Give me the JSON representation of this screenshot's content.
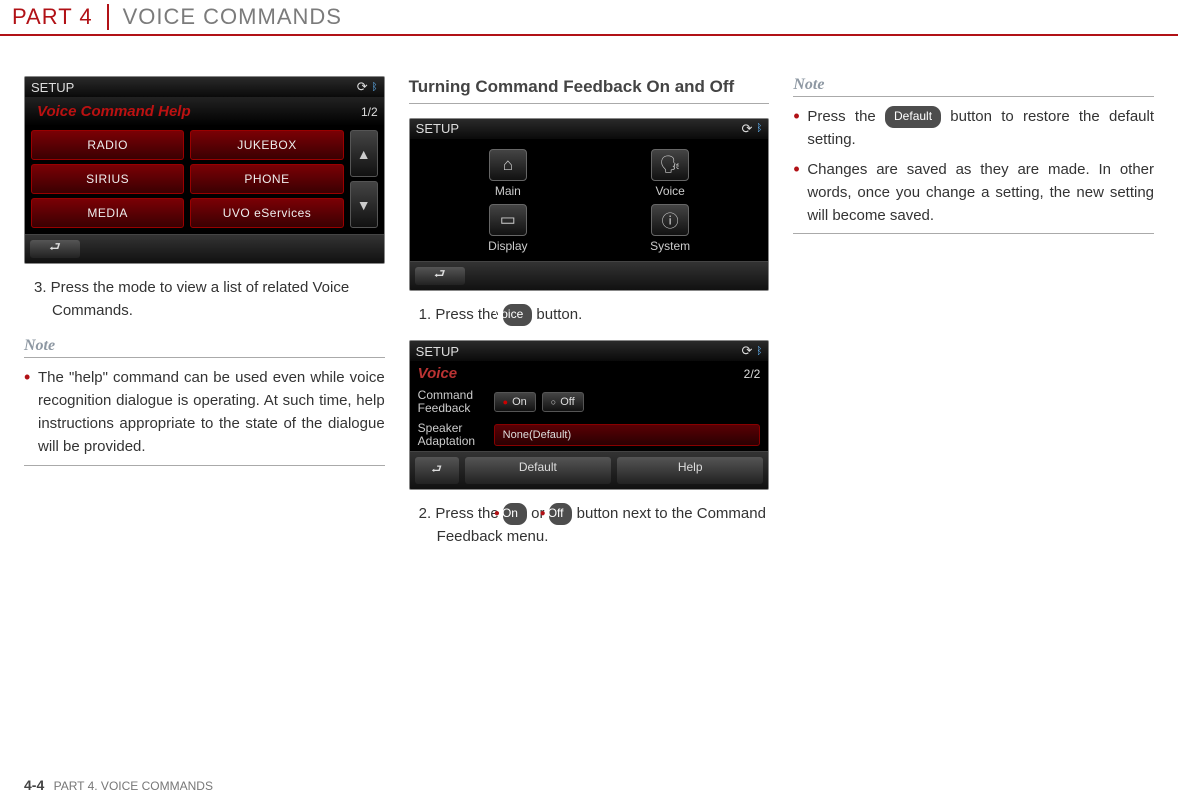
{
  "header": {
    "part": "PART 4",
    "title": "VOICE COMMANDS"
  },
  "col1": {
    "ss": {
      "top_left": "SETUP",
      "subtitle": "Voice Command Help",
      "page_ind": "1/2",
      "buttons": [
        "RADIO",
        "JUKEBOX",
        "SIRIUS",
        "PHONE",
        "MEDIA",
        "UVO eServices"
      ]
    },
    "step3": "3. Press the mode to view a list of related Voice Commands.",
    "note_h": "Note",
    "note1": "The \"help\" command can be used even while voice recognition dialogue is operating. At such time, help instructions appropriate to the state of the dialogue will be provided."
  },
  "col2": {
    "section": "Turning Command Feedback On and Off",
    "ss1": {
      "top_left": "SETUP",
      "tiles": [
        "Main",
        "Voice",
        "Display",
        "System"
      ]
    },
    "step1_a": "1. Press the ",
    "step1_btn": "Voice",
    "step1_b": " button.",
    "ss2": {
      "top_left": "SETUP",
      "subtitle": "Voice",
      "page_ind": "2/2",
      "row1_label": "Command Feedback",
      "row1_on": "On",
      "row1_off": "Off",
      "row2_label": "Speaker Adaptation",
      "row2_val": "None(Default)",
      "bottom": [
        "Default",
        "Help"
      ]
    },
    "step2_a": "2. Press the ",
    "step2_on": "On",
    "step2_mid": " or ",
    "step2_off": "Off",
    "step2_b": " button next to the Command Feedback menu."
  },
  "col3": {
    "note_h": "Note",
    "note1_a": "Press the ",
    "note1_btn": "Default",
    "note1_b": " button to restore the default setting.",
    "note2": "Changes are saved as they are made. In other words, once you change a setting, the new setting will become saved."
  },
  "footer": {
    "page": "4-4",
    "text": "PART 4. VOICE COMMANDS"
  }
}
